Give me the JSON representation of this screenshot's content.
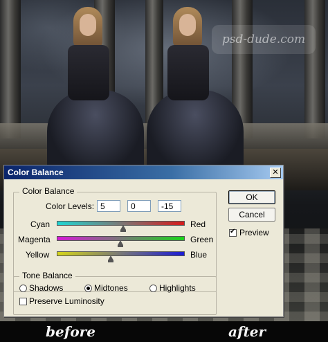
{
  "watermark": "psd-dude.com",
  "captions": {
    "before": "before",
    "after": "after"
  },
  "dialog": {
    "title": "Color Balance",
    "close_glyph": "✕",
    "color_balance_group": "Color Balance",
    "color_levels_label": "Color Levels:",
    "levels": [
      "5",
      "0",
      "-15"
    ],
    "sliders": [
      {
        "left": "Cyan",
        "right": "Red",
        "value": 5,
        "min": -100,
        "max": 100,
        "gradient": [
          "#1fd5d2",
          "#d51a1a"
        ]
      },
      {
        "left": "Magenta",
        "right": "Green",
        "value": 0,
        "min": -100,
        "max": 100,
        "gradient": [
          "#d51ad5",
          "#1ad51a"
        ]
      },
      {
        "left": "Yellow",
        "right": "Blue",
        "value": -15,
        "min": -100,
        "max": 100,
        "gradient": [
          "#d5d51a",
          "#1a1ad5"
        ]
      }
    ],
    "tone_balance_group": "Tone Balance",
    "tones": [
      {
        "label": "Shadows",
        "selected": false
      },
      {
        "label": "Midtones",
        "selected": true
      },
      {
        "label": "Highlights",
        "selected": false
      }
    ],
    "preserve_luminosity": {
      "label": "Preserve Luminosity",
      "checked": false
    },
    "ok_label": "OK",
    "cancel_label": "Cancel",
    "preview": {
      "label": "Preview",
      "checked": true
    }
  }
}
